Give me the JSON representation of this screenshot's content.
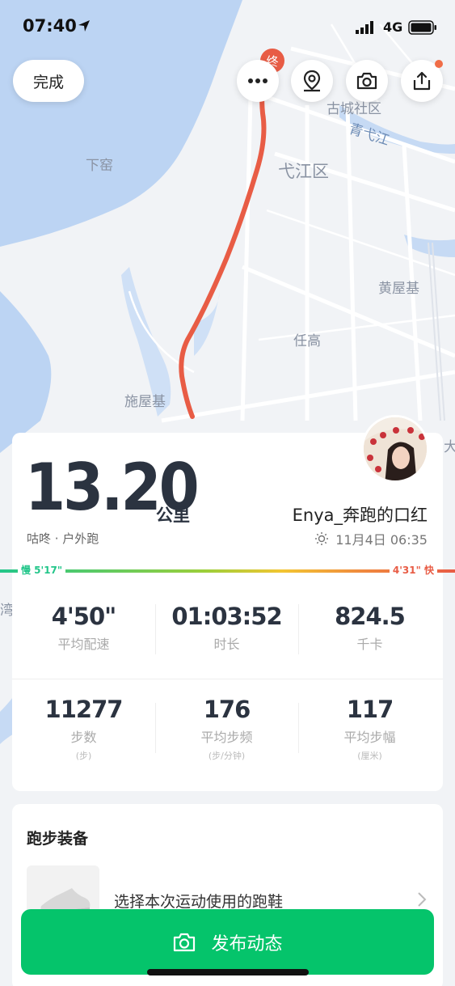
{
  "status_bar": {
    "time": "07:40",
    "network": "4G"
  },
  "top_bar": {
    "done_label": "完成",
    "end_marker": "终"
  },
  "map_labels": {
    "xiayao": "下窑",
    "gucheng": "古城社区",
    "qingyijiang": "青弋江",
    "yijiang": "弋江区",
    "huangwuji": "黄屋基",
    "rengao": "任高",
    "shiwuji": "施屋基",
    "da": "大",
    "wan": "湾"
  },
  "summary": {
    "distance": "13.20",
    "unit": "公里",
    "run_type": "咕咚 · 户外跑",
    "user_name": "Enya_奔跑的口红",
    "datetime": "11月4日 06:35",
    "pace_slow": "慢 5'17\"",
    "pace_fast": "4'31\" 快"
  },
  "stats": [
    {
      "value": "4'50\"",
      "label": "平均配速",
      "unit": ""
    },
    {
      "value": "01:03:52",
      "label": "时长",
      "unit": ""
    },
    {
      "value": "824.5",
      "label": "千卡",
      "unit": ""
    },
    {
      "value": "11277",
      "label": "步数",
      "unit": "(步)"
    },
    {
      "value": "176",
      "label": "平均步频",
      "unit": "(步/分钟)"
    },
    {
      "value": "117",
      "label": "平均步幅",
      "unit": "(厘米)"
    }
  ],
  "gear": {
    "title": "跑步装备",
    "select_label": "选择本次运动使用的跑鞋"
  },
  "publish_label": "发布动态",
  "colors": {
    "route": "#e85c45",
    "accent_green": "#05c46b",
    "water": "#bcd4f3"
  }
}
